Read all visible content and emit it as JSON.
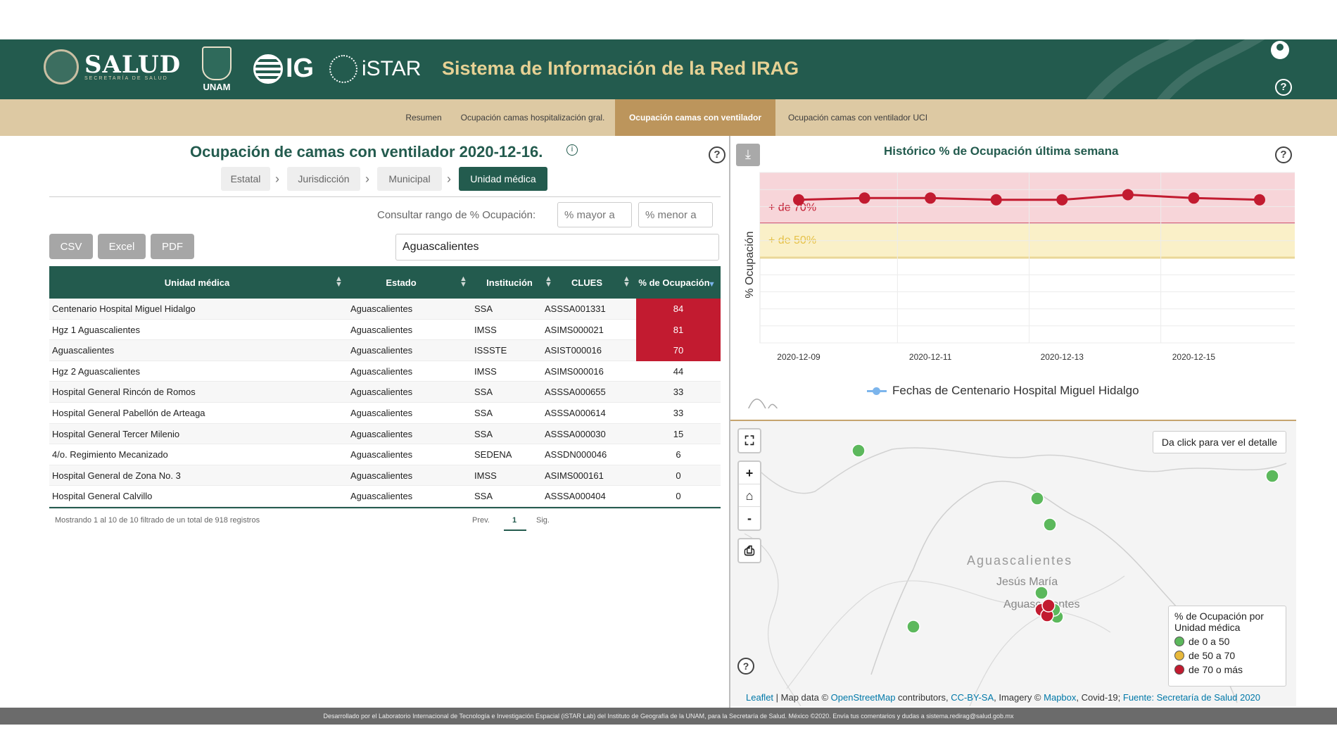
{
  "header": {
    "logos": {
      "salud": "SALUD",
      "salud_sub": "SECRETARÍA DE SALUD",
      "unam": "UNAM",
      "ig": "IG",
      "istar": "iSTAR"
    },
    "title": "Sistema de Información de la Red IRAG",
    "user_icon": "user-circle-icon",
    "help_icon": "question-circle-icon"
  },
  "tabs": [
    {
      "label": "Resumen",
      "active": false
    },
    {
      "label": "Ocupación camas hospitalización gral.",
      "active": false
    },
    {
      "label": "Ocupación camas con ventilador",
      "active": true
    },
    {
      "label": "Ocupación camas con ventilador UCI",
      "active": false
    }
  ],
  "left": {
    "title": "Ocupación de camas con ventilador 2020-12-16.",
    "breadcrumb": [
      "Estatal",
      "Jurisdicción",
      "Municipal",
      "Unidad médica"
    ],
    "range_label": "Consultar rango de % Ocupación:",
    "range_min_placeholder": "% mayor a",
    "range_max_placeholder": "% menor a",
    "export_buttons": [
      "CSV",
      "Excel",
      "PDF"
    ],
    "search_value": "Aguascalientes",
    "table": {
      "columns": [
        "Unidad médica",
        "Estado",
        "Institución",
        "CLUES",
        "% de Ocupación"
      ],
      "rows": [
        [
          "Centenario Hospital Miguel Hidalgo",
          "Aguascalientes",
          "SSA",
          "ASSSA001331",
          "84"
        ],
        [
          "Hgz 1 Aguascalientes",
          "Aguascalientes",
          "IMSS",
          "ASIMS000021",
          "81"
        ],
        [
          "Aguascalientes",
          "Aguascalientes",
          "ISSSTE",
          "ASIST000016",
          "70"
        ],
        [
          "Hgz 2 Aguascalientes",
          "Aguascalientes",
          "IMSS",
          "ASIMS000016",
          "44"
        ],
        [
          "Hospital General Rincón de Romos",
          "Aguascalientes",
          "SSA",
          "ASSSA000655",
          "33"
        ],
        [
          "Hospital General Pabellón de Arteaga",
          "Aguascalientes",
          "SSA",
          "ASSSA000614",
          "33"
        ],
        [
          "Hospital General Tercer Milenio",
          "Aguascalientes",
          "SSA",
          "ASSSA000030",
          "15"
        ],
        [
          "4/o. Regimiento Mecanizado",
          "Aguascalientes",
          "SEDENA",
          "ASSDN000046",
          "6"
        ],
        [
          "Hospital General de Zona No. 3",
          "Aguascalientes",
          "IMSS",
          "ASIMS000161",
          "0"
        ],
        [
          "Hospital General Calvillo",
          "Aguascalientes",
          "SSA",
          "ASSSA000404",
          "0"
        ]
      ]
    },
    "footer_note": "Mostrando 1 al 10 de 10 filtrado de un total de 918 registros",
    "pager": {
      "prev": "Prev.",
      "current": "1",
      "next": "Sig."
    }
  },
  "chart": {
    "title": "Histórico % de Ocupación última semana",
    "download_icon": "download-icon",
    "legend": "Fechas de Centenario Hospital Miguel Hidalgo"
  },
  "chart_data": {
    "type": "line",
    "ylabel": "% Ocupación",
    "x": [
      "2020-12-09",
      "2020-12-10",
      "2020-12-11",
      "2020-12-12",
      "2020-12-13",
      "2020-12-14",
      "2020-12-15",
      "2020-12-16"
    ],
    "x_tick_labels": [
      "2020-12-09",
      "2020-12-11",
      "2020-12-13",
      "2020-12-15"
    ],
    "series": [
      {
        "values": [
          84,
          85,
          85,
          84,
          84,
          87,
          85,
          84
        ],
        "color": "#c21b30"
      }
    ],
    "ylim": [
      0,
      100
    ],
    "bands": [
      {
        "label": "+ de 70%",
        "from": 70,
        "to": 100,
        "color": "#f7d5d9",
        "line": "#c21b30"
      },
      {
        "label": "+ de 50%",
        "from": 50,
        "to": 70,
        "color": "#faf0c8",
        "line": "#e5c148"
      }
    ],
    "grid": true
  },
  "map": {
    "detail_button": "Da click para ver el detalle",
    "labels": [
      "Aguascalientes",
      "Jesús María",
      "Aguascalientes"
    ],
    "controls": [
      "fullscreen-icon",
      "zoom-in-icon",
      "home-icon",
      "zoom-out-icon",
      "print-icon"
    ],
    "control_glyphs": {
      "zoom_in": "+",
      "zoom_out": "-"
    },
    "legend_title": "% de Ocupación por Unidad médica",
    "legend_items": [
      {
        "label": "de 0 a 50",
        "color": "#5cb85c"
      },
      {
        "label": "de 50 a 70",
        "color": "#e8b93c"
      },
      {
        "label": "de 70 o más",
        "color": "#c21b30"
      }
    ],
    "attribution": {
      "leaflet": "Leaflet",
      "map_data": " | Map data © ",
      "osm": "OpenStreetMap",
      "contributors": " contributors, ",
      "license": "CC-BY-SA",
      "imagery": ", Imagery © ",
      "mapbox": "Mapbox",
      "covid": ", Covid-19; ",
      "source": "Fuente: Secretaría de Salud 2020"
    }
  },
  "footer": {
    "text": "Desarrollado por el Laboratorio Internacional de Tecnología e Investigación Espacial (iSTAR Lab) del Instituto de Geografía de la UNAM, para la Secretaría de Salud. México ©2020. Envía tus comentarios y dudas a sistema.redirag@salud.gob.mx"
  }
}
